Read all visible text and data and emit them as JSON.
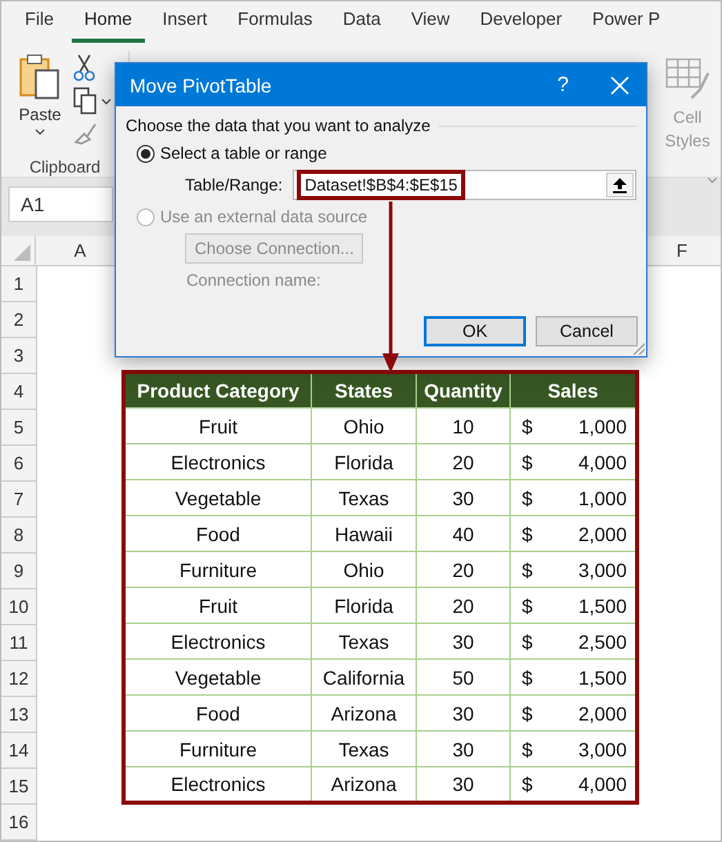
{
  "ribbon_tabs": [
    {
      "label": "File",
      "selected": false
    },
    {
      "label": "Home",
      "selected": true
    },
    {
      "label": "Insert",
      "selected": false
    },
    {
      "label": "Formulas",
      "selected": false
    },
    {
      "label": "Data",
      "selected": false
    },
    {
      "label": "View",
      "selected": false
    },
    {
      "label": "Developer",
      "selected": false
    },
    {
      "label": "Power P",
      "selected": false
    }
  ],
  "clipboard_group": {
    "paste_label": "Paste",
    "label": "Clipboard"
  },
  "styles_group": {
    "line_1": "Cell",
    "line_2": "Styles"
  },
  "name_box": "A1",
  "column_headers": [
    "A",
    "F"
  ],
  "row_numbers": [
    "1",
    "2",
    "3",
    "4",
    "5",
    "6",
    "7",
    "8",
    "9",
    "10",
    "11",
    "12",
    "13",
    "14",
    "15",
    "16"
  ],
  "table": {
    "columns": [
      "Product Category",
      "States",
      "Quantity",
      "Sales"
    ],
    "rows": [
      {
        "category": "Fruit",
        "state": "Ohio",
        "quantity": "10",
        "currency": "$",
        "sales": "1,000"
      },
      {
        "category": "Electronics",
        "state": "Florida",
        "quantity": "20",
        "currency": "$",
        "sales": "4,000"
      },
      {
        "category": "Vegetable",
        "state": "Texas",
        "quantity": "30",
        "currency": "$",
        "sales": "1,000"
      },
      {
        "category": "Food",
        "state": "Hawaii",
        "quantity": "40",
        "currency": "$",
        "sales": "2,000"
      },
      {
        "category": "Furniture",
        "state": "Ohio",
        "quantity": "20",
        "currency": "$",
        "sales": "3,000"
      },
      {
        "category": "Fruit",
        "state": "Florida",
        "quantity": "20",
        "currency": "$",
        "sales": "1,500"
      },
      {
        "category": "Electronics",
        "state": "Texas",
        "quantity": "30",
        "currency": "$",
        "sales": "2,500"
      },
      {
        "category": "Vegetable",
        "state": "California",
        "quantity": "50",
        "currency": "$",
        "sales": "1,500"
      },
      {
        "category": "Food",
        "state": "Arizona",
        "quantity": "30",
        "currency": "$",
        "sales": "2,000"
      },
      {
        "category": "Furniture",
        "state": "Texas",
        "quantity": "30",
        "currency": "$",
        "sales": "3,000"
      },
      {
        "category": "Electronics",
        "state": "Arizona",
        "quantity": "30",
        "currency": "$",
        "sales": "4,000"
      }
    ]
  },
  "dialog": {
    "title": "Move PivotTable",
    "help": "?",
    "section": "Choose the data that you want to analyze",
    "options": [
      {
        "label": "Select a table or range",
        "selected": true,
        "disabled": false
      },
      {
        "label": "Use an external data source",
        "selected": false,
        "disabled": true
      }
    ],
    "range_label": "Table/Range:",
    "range_value": "Dataset!$B$4:$E$15",
    "choose_button": {
      "label": "Choose Connection...",
      "disabled": true
    },
    "connection_label": "Connection name:",
    "buttons": [
      {
        "label": "OK",
        "kind": "default"
      },
      {
        "label": "Cancel",
        "kind": "normal"
      }
    ]
  }
}
